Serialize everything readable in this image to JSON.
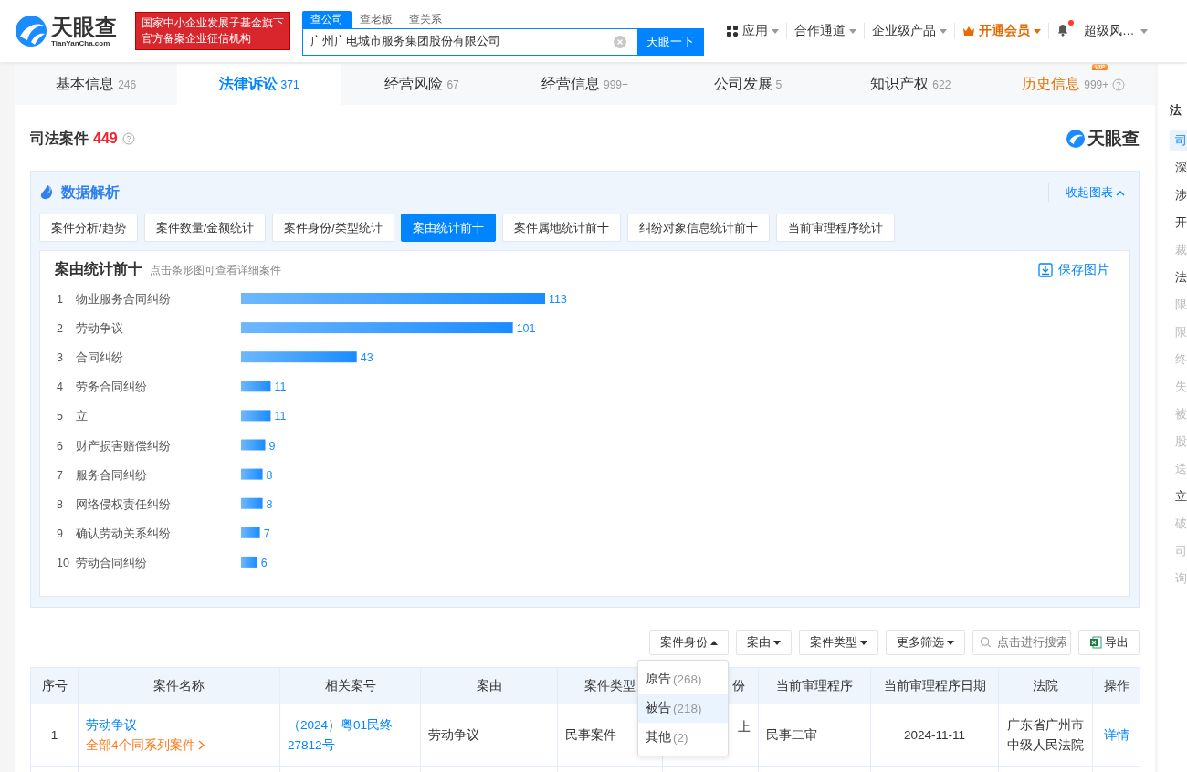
{
  "header": {
    "logo": "天眼查",
    "logo_sub": "TianYanCha.com",
    "badge_lines": [
      "国家中小企业发展子基金旗下",
      "官方备案企业征信机构"
    ],
    "search_tabs": [
      {
        "label": "查公司",
        "selected": true
      },
      {
        "label": "查老板",
        "selected": false
      },
      {
        "label": "查关系",
        "selected": false
      }
    ],
    "search": {
      "value": "广州广电城市服务集团股份有限公司",
      "button": "天眼一下"
    },
    "nav": [
      {
        "label": "应用",
        "kind": "apps"
      },
      {
        "label": "合作通道",
        "kind": "menu"
      },
      {
        "label": "企业级产品",
        "kind": "menu"
      },
      {
        "label": "开通会员",
        "kind": "vip"
      }
    ],
    "notification": true,
    "user": "超级风…"
  },
  "nav_tabs": [
    {
      "label": "基本信息",
      "count": "246",
      "selected": false,
      "vip": false
    },
    {
      "label": "法律诉讼",
      "count": "371",
      "selected": true,
      "vip": false
    },
    {
      "label": "经营风险",
      "count": "67",
      "selected": false,
      "vip": false
    },
    {
      "label": "经营信息",
      "count": "999+",
      "selected": false,
      "vip": false
    },
    {
      "label": "公司发展",
      "count": "5",
      "selected": false,
      "vip": false
    },
    {
      "label": "知识产权",
      "count": "622",
      "selected": false,
      "vip": false
    },
    {
      "label": "历史信息",
      "count": "999+",
      "selected": false,
      "vip": true,
      "vip_badge": "VIP"
    }
  ],
  "section": {
    "title": "司法案件",
    "count": "449",
    "logo": "天眼查"
  },
  "analysis": {
    "title": "数据解析",
    "collapse": "收起图表",
    "tabs": [
      {
        "label": "案件分析/趋势",
        "selected": false
      },
      {
        "label": "案件数量/金额统计",
        "selected": false
      },
      {
        "label": "案件身份/类型统计",
        "selected": false
      },
      {
        "label": "案由统计前十",
        "selected": true
      },
      {
        "label": "案件属地统计前十",
        "selected": false
      },
      {
        "label": "纠纷对象信息统计前十",
        "selected": false
      },
      {
        "label": "当前审理程序统计",
        "selected": false
      }
    ],
    "chart_title": "案由统计前十",
    "chart_hint": "点击条形图可查看详细案件",
    "save": "保存图片",
    "ranks": [
      "1",
      "2",
      "3",
      "4",
      "5",
      "6",
      "7",
      "8",
      "9",
      "10"
    ],
    "chart_data": {
      "type": "bar",
      "orientation": "horizontal",
      "data_labels": true,
      "categories": [
        "物业服务合同纠纷",
        "劳动争议",
        "合同纠纷",
        "劳务合同纠纷",
        "立",
        "财产损害赔偿纠纷",
        "服务合同纠纷",
        "网络侵权责任纠纷",
        "确认劳动关系纠纷",
        "劳动合同纠纷"
      ],
      "values": [
        113,
        101,
        43,
        11,
        11,
        9,
        8,
        8,
        7,
        6
      ]
    }
  },
  "filters": [
    {
      "label": "案件身份",
      "open": true
    },
    {
      "label": "案由",
      "open": false
    },
    {
      "label": "案件类型",
      "open": false
    },
    {
      "label": "更多筛选",
      "open": false
    }
  ],
  "filter_search": {
    "placeholder": "点击进行搜索"
  },
  "export": "导出",
  "dropdown": [
    {
      "label": "原告",
      "count": "(268)",
      "selected": false
    },
    {
      "label": "被告",
      "count": "(218)",
      "selected": true
    },
    {
      "label": "其他",
      "count": "(2)",
      "selected": false
    }
  ],
  "table": {
    "columns": [
      "序号",
      "案件名称",
      "相关案号",
      "案由",
      "案件类型",
      "份",
      "当前审理程序",
      "当前审理程序日期",
      "法院",
      "操作"
    ],
    "rows": [
      {
        "index": "1",
        "name": "劳动争议",
        "series": "全部4个同系列案件",
        "case_no": "（2024）粤01民终27812号",
        "cause": "劳动争议",
        "type": "民事案件",
        "role": "上",
        "procedure": "民事二审",
        "date": "2024-11-11",
        "court": "广东省广州市中级人民法院",
        "action": "详情"
      }
    ]
  },
  "sidebar": {
    "title": "法",
    "items": [
      {
        "label": "司",
        "selected": true,
        "disabled": false
      },
      {
        "label": "深",
        "selected": false,
        "disabled": false
      },
      {
        "label": "涉",
        "selected": false,
        "disabled": false
      },
      {
        "label": "开",
        "selected": false,
        "disabled": false
      },
      {
        "label": "裁",
        "selected": false,
        "disabled": true
      },
      {
        "label": "法",
        "selected": false,
        "disabled": false
      },
      {
        "label": "限",
        "selected": false,
        "disabled": true
      },
      {
        "label": "限",
        "selected": false,
        "disabled": true
      },
      {
        "label": "终",
        "selected": false,
        "disabled": true
      },
      {
        "label": "失",
        "selected": false,
        "disabled": true
      },
      {
        "label": "被",
        "selected": false,
        "disabled": true
      },
      {
        "label": "股",
        "selected": false,
        "disabled": true
      },
      {
        "label": "送",
        "selected": false,
        "disabled": true
      },
      {
        "label": "立",
        "selected": false,
        "disabled": false
      },
      {
        "label": "破",
        "selected": false,
        "disabled": true
      },
      {
        "label": "司",
        "selected": false,
        "disabled": true
      },
      {
        "label": "询",
        "selected": false,
        "disabled": true
      }
    ]
  }
}
